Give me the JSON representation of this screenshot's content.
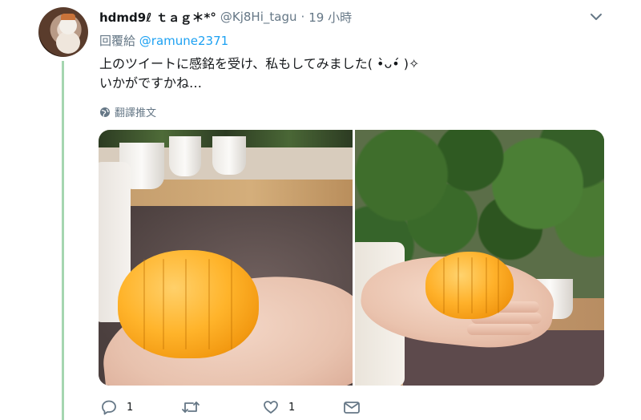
{
  "tweet": {
    "display_name": "hdmd9ℓ ｔａｇ＊*°",
    "handle": "@Kj8Hi_tagu",
    "separator": "·",
    "time": "19 小時",
    "replying_prefix": "回覆給",
    "replying_to": "@ramune2371",
    "text_line1": "上のツイートに感銘を受け、私もしてみました( •̀ᴗ•́ )✧",
    "text_line2": "いかがですかね…",
    "translate_label": "翻譯推文"
  },
  "actions": {
    "reply_count": "1",
    "retweet_count": "",
    "like_count": "1"
  },
  "icons": {
    "caret": "chevron-down-icon",
    "translate": "globe-icon",
    "reply": "reply-icon",
    "retweet": "retweet-icon",
    "like": "heart-icon",
    "dm": "envelope-icon"
  },
  "colors": {
    "link": "#1da1f2",
    "secondary_text": "#657786",
    "thread_line": "#a5d6b0"
  }
}
